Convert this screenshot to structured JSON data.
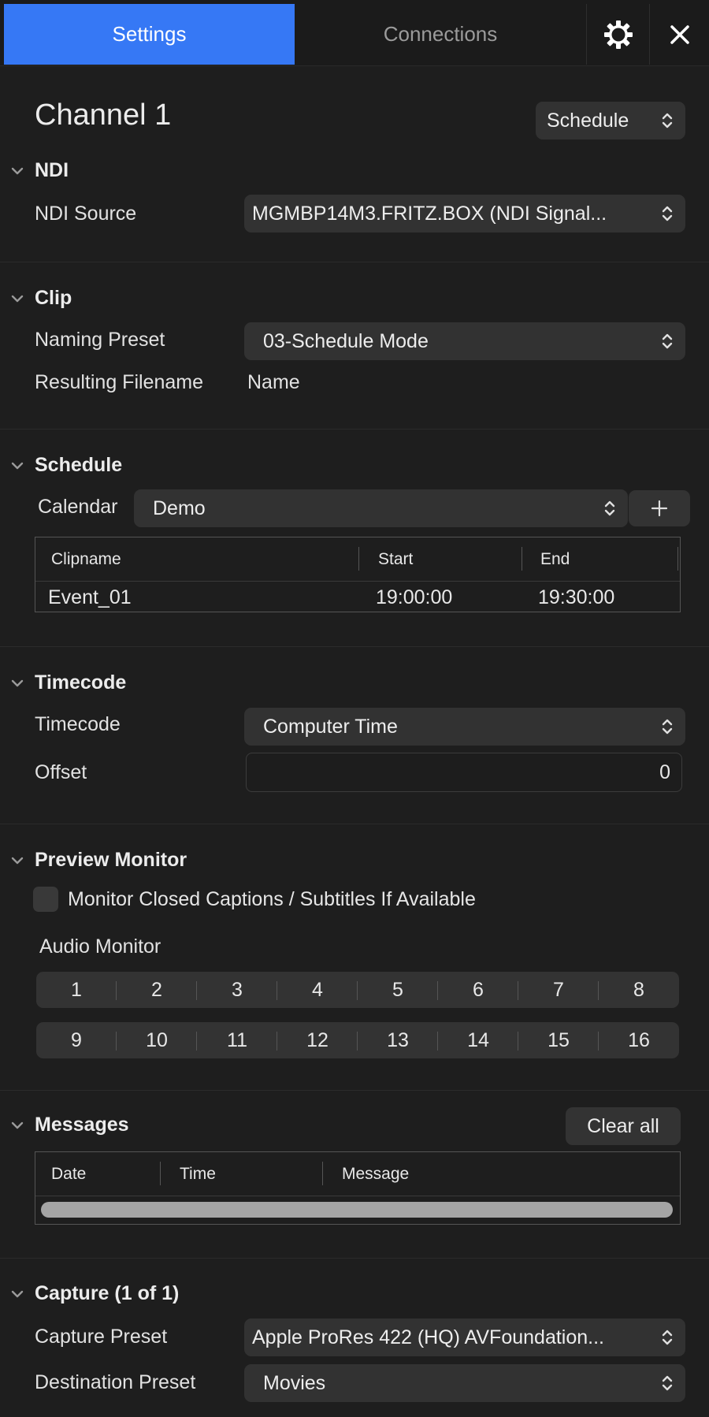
{
  "tabs": {
    "settings": "Settings",
    "connections": "Connections"
  },
  "icons": {
    "settings": "gear-icon",
    "close": "close-icon"
  },
  "colors": {
    "accent": "#3678f5",
    "background": "#1e1e1e"
  },
  "channel": {
    "title": "Channel 1",
    "mode": "Schedule"
  },
  "ndi": {
    "header": "NDI",
    "source_label": "NDI Source",
    "source_value": "MGMBP14M3.FRITZ.BOX (NDI Signal..."
  },
  "clip": {
    "header": "Clip",
    "naming_label": "Naming Preset",
    "naming_value": "03-Schedule Mode",
    "filename_label": "Resulting Filename",
    "filename_value": "Name"
  },
  "schedule": {
    "header": "Schedule",
    "calendar_label": "Calendar",
    "calendar_value": "Demo",
    "add_label": "+",
    "columns": [
      "Clipname",
      "Start",
      "End"
    ],
    "rows": [
      {
        "clipname": "Event_01",
        "start": "19:00:00",
        "end": "19:30:00"
      }
    ]
  },
  "timecode": {
    "header": "Timecode",
    "timecode_label": "Timecode",
    "timecode_value": "Computer Time",
    "offset_label": "Offset",
    "offset_value": "0"
  },
  "preview": {
    "header": "Preview Monitor",
    "captions_label": "Monitor Closed Captions / Subtitles If Available",
    "audio_label": "Audio Monitor",
    "channels_row1": [
      "1",
      "2",
      "3",
      "4",
      "5",
      "6",
      "7",
      "8"
    ],
    "channels_row2": [
      "9",
      "10",
      "11",
      "12",
      "13",
      "14",
      "15",
      "16"
    ]
  },
  "messages": {
    "header": "Messages",
    "clear_label": "Clear all",
    "columns": [
      "Date",
      "Time",
      "Message"
    ]
  },
  "capture": {
    "header": "Capture (1 of 1)",
    "preset_label": "Capture Preset",
    "preset_value": "Apple ProRes 422 (HQ) AVFoundation...",
    "destination_label": "Destination Preset",
    "destination_value": "Movies"
  }
}
